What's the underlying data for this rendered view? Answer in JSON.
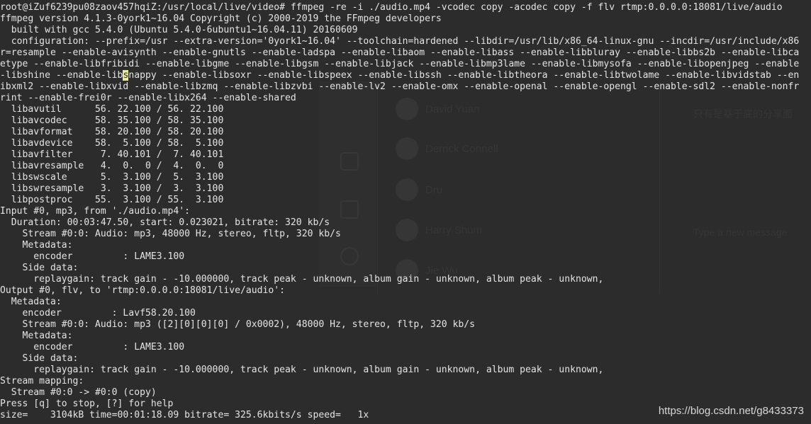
{
  "terminal": {
    "lines": [
      "root@iZuf6239pu08zaov457hqiZ:/usr/local/live/video# ffmpeg -re -i ./audio.mp4 -vcodec copy -acodec copy -f flv rtmp:0.0.0.0:18081/live/audio",
      "ffmpeg version 4.1.3-0york1~16.04 Copyright (c) 2000-2019 the FFmpeg developers",
      "  built with gcc 5.4.0 (Ubuntu 5.4.0-6ubuntu1~16.04.11) 20160609",
      "  configuration: --prefix=/usr --extra-version='0york1~16.04' --toolchain=hardened --libdir=/usr/lib/x86_64-linux-gnu --incdir=/usr/include/x86",
      "r=resample --enable-avisynth --enable-gnutls --enable-ladspa --enable-libaom --enable-libass --enable-libbluray --enable-libbs2b --enable-libca",
      "etype --enable-libfribidi --enable-libgme --enable-libgsm --enable-libjack --enable-libmp3lame --enable-libmysofa --enable-libopenjpeg --enable",
      "-libshine --enable-libsnappy --enable-libsoxr --enable-libspeex --enable-libssh --enable-libtheora --enable-libtwolame --enable-libvidstab --en",
      "ibxml2 --enable-libxvid --enable-libzmq --enable-libzvbi --enable-lv2 --enable-omx --enable-openal --enable-opengl --enable-sdl2 --enable-nonfr",
      "rint --enable-frei0r --enable-libx264 --enable-shared",
      "  libavutil      56. 22.100 / 56. 22.100",
      "  libavcodec     58. 35.100 / 58. 35.100",
      "  libavformat    58. 20.100 / 58. 20.100",
      "  libavdevice    58.  5.100 / 58.  5.100",
      "  libavfilter     7. 40.101 /  7. 40.101",
      "  libavresample   4.  0.  0 /  4.  0.  0",
      "  libswscale      5.  3.100 /  5.  3.100",
      "  libswresample   3.  3.100 /  3.  3.100",
      "  libpostproc    55.  3.100 / 55.  3.100",
      "Input #0, mp3, from './audio.mp4':",
      "  Duration: 00:03:47.50, start: 0.023021, bitrate: 320 kb/s",
      "    Stream #0:0: Audio: mp3, 48000 Hz, stereo, fltp, 320 kb/s",
      "    Metadata:",
      "      encoder         : LAME3.100",
      "    Side data:",
      "      replaygain: track gain - -10.000000, track peak - unknown, album gain - unknown, album peak - unknown,",
      "Output #0, flv, to 'rtmp:0.0.0.0:18081/live/audio':",
      "  Metadata:",
      "    encoder         : Lavf58.20.100",
      "    Stream #0:0: Audio: mp3 ([2][0][0][0] / 0x0002), 48000 Hz, stereo, fltp, 320 kb/s",
      "    Metadata:",
      "      encoder         : LAME3.100",
      "    Side data:",
      "      replaygain: track gain - -10.000000, track peak - unknown, album gain - unknown, album peak - unknown,",
      "Stream mapping:",
      "  Stream #0:0 -> #0:0 (copy)",
      "Press [q] to stop, [?] for help",
      "size=    3104kB time=00:01:18.09 bitrate= 325.6kbits/s speed=   1x"
    ]
  },
  "cursor": {
    "line_index": 6,
    "before": "-libshine --enable-lib",
    "char": "s",
    "after": "nappy --enable-libsoxr --enable-libspeex --enable-libssh --enable-libtheora --enable-libtwolame --enable-libvidstab --en"
  },
  "background_app": {
    "contacts": [
      "David Yuan",
      "Derrick Connell",
      "Dru",
      "Harry Shum",
      "Jie Wu"
    ],
    "header_text": "只有是基于底的分享面",
    "message_placeholder": "Type a new message"
  },
  "watermark": "https://blog.csdn.net/g8433373",
  "colors": {
    "background": "#2c2c2c",
    "text": "#e4e4e4",
    "cursor": "#e8e8a8"
  }
}
